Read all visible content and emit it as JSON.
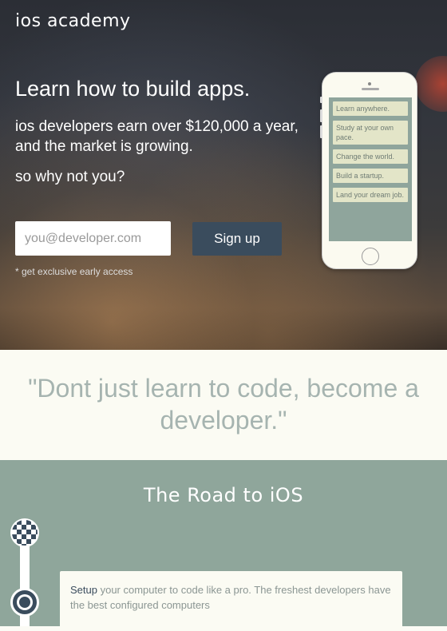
{
  "brand": "ios academy",
  "hero": {
    "headline": "Learn how to build apps.",
    "sub_prefix": "ios developers earn over ",
    "sub_money": "$120,000",
    "sub_suffix": " a year, and the market is growing.",
    "why": "so why not you?",
    "email_placeholder": "you@developer.com",
    "signup_label": "Sign up",
    "note": "* get exclusive early access"
  },
  "phone": {
    "cards": [
      "Learn anywhere.",
      "Study at your own pace.",
      "Change the world.",
      "Build a startup.",
      "Land your dream job."
    ]
  },
  "quote": "\"Dont just learn to code, become a developer.\"",
  "road": {
    "title": "The Road to iOS",
    "step_title": "Setup",
    "step_text": " your computer to code like a pro. The freshest developers have the best configured computers"
  },
  "colors": {
    "accent": "#3a4c5d",
    "road_bg": "#8fa69b",
    "quote_text": "#a6b4b0"
  }
}
